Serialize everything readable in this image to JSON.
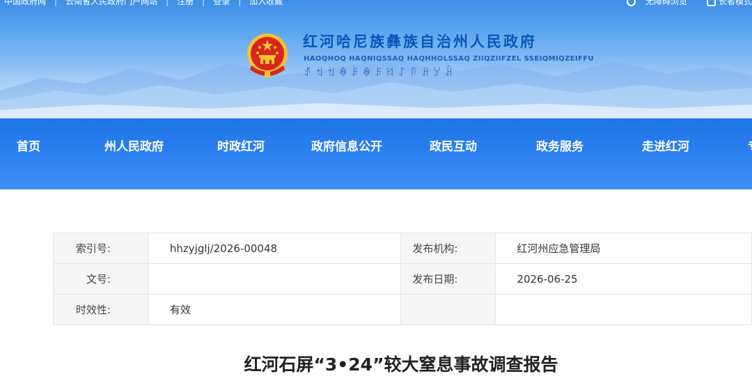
{
  "topbar": {
    "links": [
      "中国政府网",
      "云南省人民政府门户网站",
      "注册",
      "登录",
      "加入收藏"
    ],
    "accessibility": "无障碍浏览",
    "elder_mode": "长者模式"
  },
  "site": {
    "title": "红河哈尼族彝族自治州人民政府",
    "subtitle": "HAOQHOQ HAQNIQSSAQ HAQHHOLSSAQ ZIIQZIIFZEL SSEIQMIQZEIFFU",
    "yi_script": "ꀋꉬꉬꊿꌠꊿꌠꐆꋍꑍꃅꌦꃄ",
    "emblem_icon": "national-emblem-icon"
  },
  "nav": [
    "首页",
    "州人民政府",
    "时政红河",
    "政府信息公开",
    "政民互动",
    "政务服务",
    "走进红河",
    "专"
  ],
  "info": {
    "index_label": "索引号:",
    "index_value": "hhzyjglj/2026-00048",
    "publisher_label": "发布机构:",
    "publisher_value": "红河州应急管理局",
    "docno_label": "文号:",
    "docno_value": "",
    "date_label": "发布日期:",
    "date_value": "2026-06-25",
    "validity_label": "时效性:",
    "validity_value": "有效"
  },
  "article": {
    "title": "红河石屏“3•24”较大窒息事故调查报告"
  },
  "colors": {
    "nav_blue": "#2a7ff0",
    "title_blue": "#0b55b8",
    "emblem_red": "#d8261c",
    "emblem_gold": "#f2c232"
  }
}
